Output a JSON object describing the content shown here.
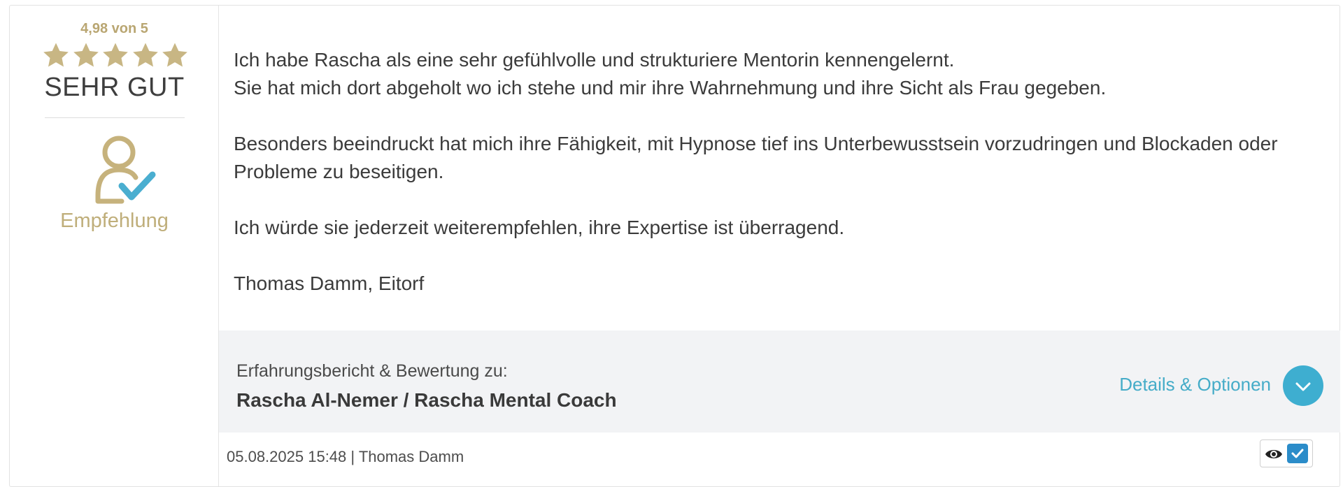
{
  "rating": {
    "score_text": "4,98 von 5",
    "stars": 5,
    "stars_filled": 5,
    "label": "SEHR GUT",
    "star_color": "#c8b684",
    "recommend_icon": "user-check-icon",
    "recommend_label": "Empfehlung"
  },
  "review": {
    "paragraphs": [
      [
        "Ich habe Rascha als eine sehr gefühlvolle und strukturiere Mentorin kennengelernt.",
        "Sie hat mich dort abgeholt wo ich stehe und mir ihre Wahrnehmung und ihre Sicht als Frau gegeben."
      ],
      [
        "Besonders beeindruckt hat mich ihre Fähigkeit, mit Hypnose tief ins Unterbewusstsein vorzudringen und Blockaden oder Probleme zu beseitigen."
      ],
      [
        "Ich würde sie jederzeit weiterempfehlen, ihre Expertise ist überragend."
      ],
      [
        "Thomas Damm, Eitorf"
      ]
    ]
  },
  "info": {
    "caption": "Erfahrungsbericht & Bewertung zu:",
    "subject": "Rascha Al-Nemer / Rascha Mental Coach",
    "details_label": "Details & Optionen",
    "details_icon": "chevron-down-icon",
    "accent_color": "#3eaed0"
  },
  "footer": {
    "meta": "05.08.2025 15:48 | Thomas Damm",
    "view_icon": "eye-icon",
    "verified_icon": "checkmark-icon"
  }
}
